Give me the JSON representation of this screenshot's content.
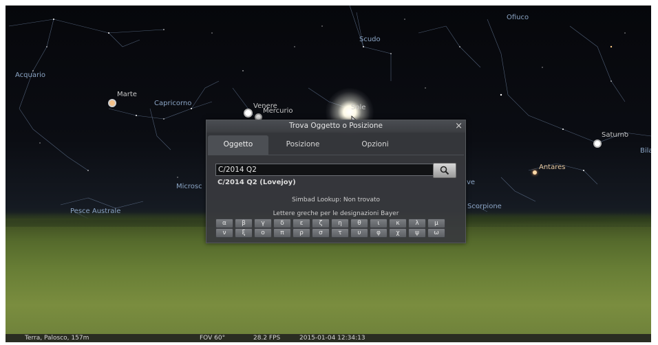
{
  "sky_labels": {
    "ofiuco": "Ofiuco",
    "scudo": "Scudo",
    "acquario": "Acquario",
    "capricorno": "Capricorno",
    "marte": "Marte",
    "venere": "Venere",
    "mercurio": "Mercurio",
    "sole": "Sole",
    "saturno": "Saturno",
    "bilancia": "Bila",
    "antares": "Antares",
    "microscopio": "Microsc",
    "pesce_australe": "Pesce Australe",
    "scorpione": "Scorpione",
    "ve": "ve"
  },
  "dialog": {
    "title": "Trova Oggetto o Posizione",
    "close_label": "×",
    "tabs": [
      {
        "label": "Oggetto",
        "active": true
      },
      {
        "label": "Posizione",
        "active": false
      },
      {
        "label": "Opzioni",
        "active": false
      }
    ],
    "search_value": "C/2014 Q2",
    "completion": "C/2014 Q2 (Lovejoy)",
    "simbad_status": "Simbad Lookup: Non trovato",
    "greek_caption": "Lettere greche per le designazioni Bayer",
    "greek_row_1": [
      "α",
      "β",
      "γ",
      "δ",
      "ε",
      "ζ",
      "η",
      "θ",
      "ι",
      "κ",
      "λ",
      "μ"
    ],
    "greek_row_2": [
      "ν",
      "ξ",
      "ο",
      "π",
      "ρ",
      "σ",
      "τ",
      "υ",
      "φ",
      "χ",
      "ψ",
      "ω"
    ]
  },
  "status_bar": {
    "location": "Terra, Palosco, 157m",
    "fov": "FOV 60°",
    "fps": "28.2 FPS",
    "datetime": "2015-01-04  12:34:13"
  },
  "icons": {
    "search": "search-icon",
    "close": "close-icon",
    "cursor": "cursor-icon"
  },
  "colors": {
    "constellation_label": "#8ca6c6",
    "dialog_bg": "#383a3e",
    "sun": "#fffbe8"
  }
}
